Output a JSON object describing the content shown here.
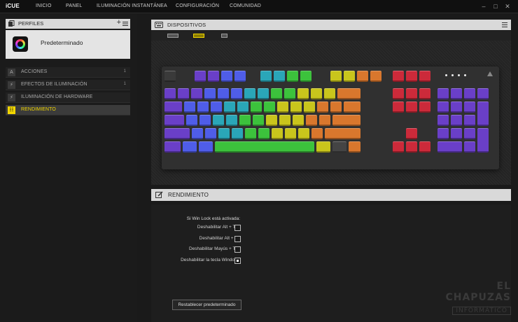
{
  "app": {
    "brand": "iCUE"
  },
  "nav": [
    "INICIO",
    "PANEL",
    "ILUMINACIÓN INSTANTÁNEA",
    "CONFIGURACIÓN",
    "COMUNIDAD"
  ],
  "profiles": {
    "title": "PERFILES",
    "add_icon": "plus-icon",
    "menu_icon": "hamburger-icon",
    "current": "Predeterminado"
  },
  "sidebar": {
    "items": [
      {
        "label": "ACCIONES",
        "count": "1",
        "icon": "A"
      },
      {
        "label": "EFECTOS DE ILUMINACIÓN",
        "count": "1",
        "icon": "⚡"
      },
      {
        "label": "ILUMINACIÓN DE HARDWARE",
        "count": "",
        "icon": "⚡"
      },
      {
        "label": "RENDIMIENTO",
        "count": "",
        "icon": "☷"
      }
    ]
  },
  "devices": {
    "title": "DISPOSITIVOS"
  },
  "performance": {
    "title": "RENDIMIENTO",
    "heading": "Si Win Lock está activada:",
    "options": [
      {
        "label": "Deshabilitar Alt + Tab",
        "checked": false
      },
      {
        "label": "Deshabilitar Alt + F4",
        "checked": false
      },
      {
        "label": "Deshabilitar Mayús + Tab",
        "checked": false
      },
      {
        "label": "Deshabilitar la tecla Windows",
        "checked": true
      }
    ],
    "reset_label": "Restablecer predeterminado"
  },
  "watermark": {
    "line1": "EL CHAPUZAS",
    "line2": "INFORMÁTICO"
  },
  "colors": {
    "accent": "#f2d600",
    "key_purple": "#6a3fc8",
    "key_blue": "#4f5de8",
    "key_teal": "#2aa6b8",
    "key_green": "#3cc23c",
    "key_yellow": "#c9c51c",
    "key_orange": "#d9772d",
    "key_red": "#cc2a3a"
  }
}
